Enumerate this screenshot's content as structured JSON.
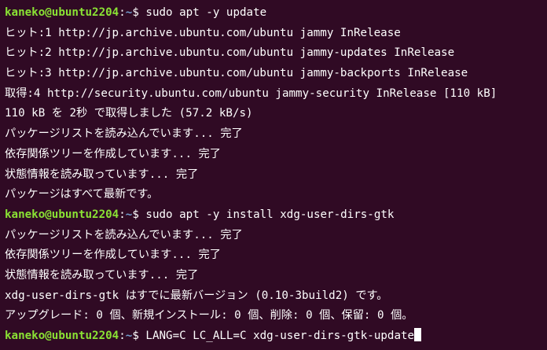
{
  "terminal": {
    "background": "#300a24",
    "prompt": {
      "user_host": "kaneko@ubuntu2204",
      "path": "~",
      "separator_colon": ":",
      "separator_dollar": "$ ",
      "user_host_color": "#8ae234",
      "path_color": "#729fcf"
    },
    "lines": [
      {
        "type": "prompt",
        "command": "sudo apt -y update"
      },
      {
        "type": "output",
        "text": "ヒット:1 http://jp.archive.ubuntu.com/ubuntu jammy InRelease"
      },
      {
        "type": "output",
        "text": "ヒット:2 http://jp.archive.ubuntu.com/ubuntu jammy-updates InRelease"
      },
      {
        "type": "output",
        "text": "ヒット:3 http://jp.archive.ubuntu.com/ubuntu jammy-backports InRelease"
      },
      {
        "type": "output",
        "text": "取得:4 http://security.ubuntu.com/ubuntu jammy-security InRelease [110 kB]"
      },
      {
        "type": "output",
        "text": "110 kB を 2秒 で取得しました (57.2 kB/s)"
      },
      {
        "type": "output",
        "text": "パッケージリストを読み込んでいます... 完了"
      },
      {
        "type": "output",
        "text": "依存関係ツリーを作成しています... 完了"
      },
      {
        "type": "output",
        "text": "状態情報を読み取っています... 完了"
      },
      {
        "type": "output",
        "text": "パッケージはすべて最新です。"
      },
      {
        "type": "prompt",
        "command": "sudo apt -y install xdg-user-dirs-gtk"
      },
      {
        "type": "output",
        "text": "パッケージリストを読み込んでいます... 完了"
      },
      {
        "type": "output",
        "text": "依存関係ツリーを作成しています... 完了"
      },
      {
        "type": "output",
        "text": "状態情報を読み取っています... 完了"
      },
      {
        "type": "output",
        "text": "xdg-user-dirs-gtk はすでに最新バージョン (0.10-3build2) です。"
      },
      {
        "type": "output",
        "text": "アップグレード: 0 個、新規インストール: 0 個、削除: 0 個、保留: 0 個。"
      },
      {
        "type": "prompt",
        "command": "LANG=C LC_ALL=C xdg-user-dirs-gtk-update"
      }
    ]
  }
}
